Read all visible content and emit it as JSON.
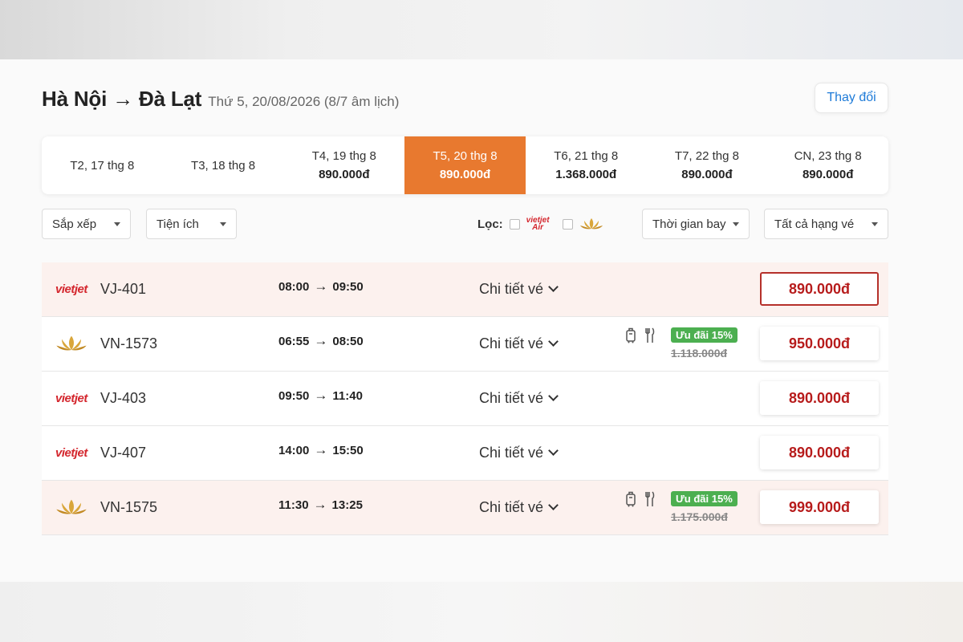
{
  "header": {
    "route": "Hà Nội → Đà Lạt",
    "date_line": "Thứ 5, 20/08/2026 (8/7 âm lịch)",
    "change_label": "Thay đổi"
  },
  "dates": [
    {
      "label": "T2, 17 thg 8",
      "price": ""
    },
    {
      "label": "T3, 18 thg 8",
      "price": ""
    },
    {
      "label": "T4, 19 thg 8",
      "price": "890.000đ"
    },
    {
      "label": "T5, 20 thg 8",
      "price": "890.000đ"
    },
    {
      "label": "T6, 21 thg 8",
      "price": "1.368.000đ"
    },
    {
      "label": "T7, 22 thg 8",
      "price": "890.000đ"
    },
    {
      "label": "CN, 23 thg 8",
      "price": "890.000đ"
    }
  ],
  "filters": {
    "sort_label": "Sắp xếp",
    "amenities_label": "Tiện ích",
    "filter_label": "Lọc:",
    "vietjet_small": "vietjet",
    "vietjet_small_sub": "Air",
    "flight_time_label": "Thời gian bay",
    "class_label": "Tất cả hạng vé"
  },
  "flights": [
    {
      "airline": "vietjet",
      "logo_text": "vietjet",
      "code": "VJ-401",
      "depart": "08:00",
      "arrive": "09:50",
      "detail": "Chi tiết vé",
      "promo": "",
      "old_price": "",
      "price": "890.000đ"
    },
    {
      "airline": "vietnam-airlines",
      "logo_text": "",
      "code": "VN-1573",
      "depart": "06:55",
      "arrive": "08:50",
      "detail": "Chi tiết vé",
      "promo": "Ưu đãi 15%",
      "old_price": "1.118.000đ",
      "price": "950.000đ"
    },
    {
      "airline": "vietjet",
      "logo_text": "vietjet",
      "code": "VJ-403",
      "depart": "09:50",
      "arrive": "11:40",
      "detail": "Chi tiết vé",
      "promo": "",
      "old_price": "",
      "price": "890.000đ"
    },
    {
      "airline": "vietjet",
      "logo_text": "vietjet",
      "code": "VJ-407",
      "depart": "14:00",
      "arrive": "15:50",
      "detail": "Chi tiết vé",
      "promo": "",
      "old_price": "",
      "price": "890.000đ"
    },
    {
      "airline": "vietnam-airlines",
      "logo_text": "",
      "code": "VN-1575",
      "depart": "11:30",
      "arrive": "13:25",
      "detail": "Chi tiết vé",
      "promo": "Ưu đãi 15%",
      "old_price": "1.175.000đ",
      "price": "999.000đ"
    }
  ],
  "colors": {
    "accent_orange": "#e8792f",
    "price_red": "#b71c1c",
    "promo_green": "#4caf50",
    "link_blue": "#1e7bd8",
    "vietjet_red": "#d4272e",
    "lotus_gold": "#d9a63a"
  }
}
